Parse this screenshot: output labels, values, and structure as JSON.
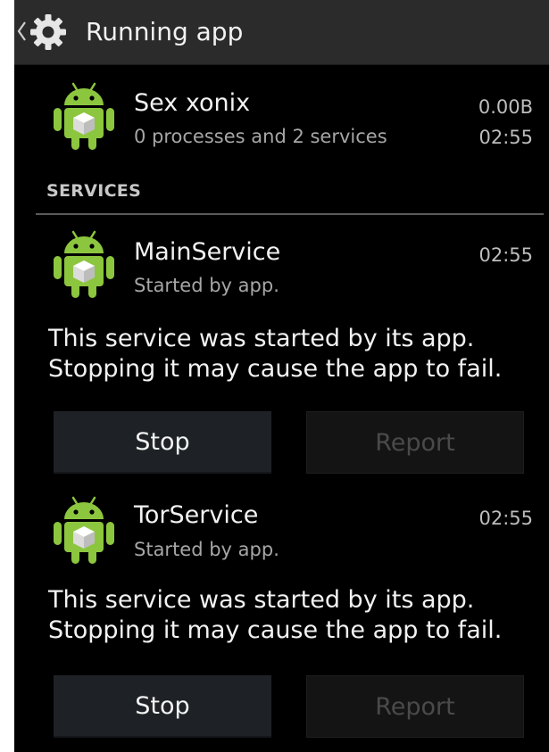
{
  "actionbar": {
    "title": "Running app"
  },
  "app": {
    "name": "Sex xonix",
    "summary": "0 processes and 2 services",
    "size": "0.00B",
    "time": "02:55"
  },
  "services_header": "SERVICES",
  "services": [
    {
      "name": "MainService",
      "started_by": "Started by app.",
      "time": "02:55",
      "description": "This service was started by its app. Stopping it may cause the app to fail.",
      "stop_label": "Stop",
      "report_label": "Report"
    },
    {
      "name": "TorService",
      "started_by": "Started by app.",
      "time": "02:55",
      "description": "This service was started by its app. Stopping it may cause the app to fail.",
      "stop_label": "Stop",
      "report_label": "Report"
    }
  ],
  "icons": {
    "back": "chevron-left-icon",
    "settings": "gear-icon",
    "app": "android-robot-icon"
  },
  "colors": {
    "background": "#000000",
    "actionbar": "#2b2b2b",
    "android_green": "#8cc63f",
    "button": "#1e2226"
  }
}
